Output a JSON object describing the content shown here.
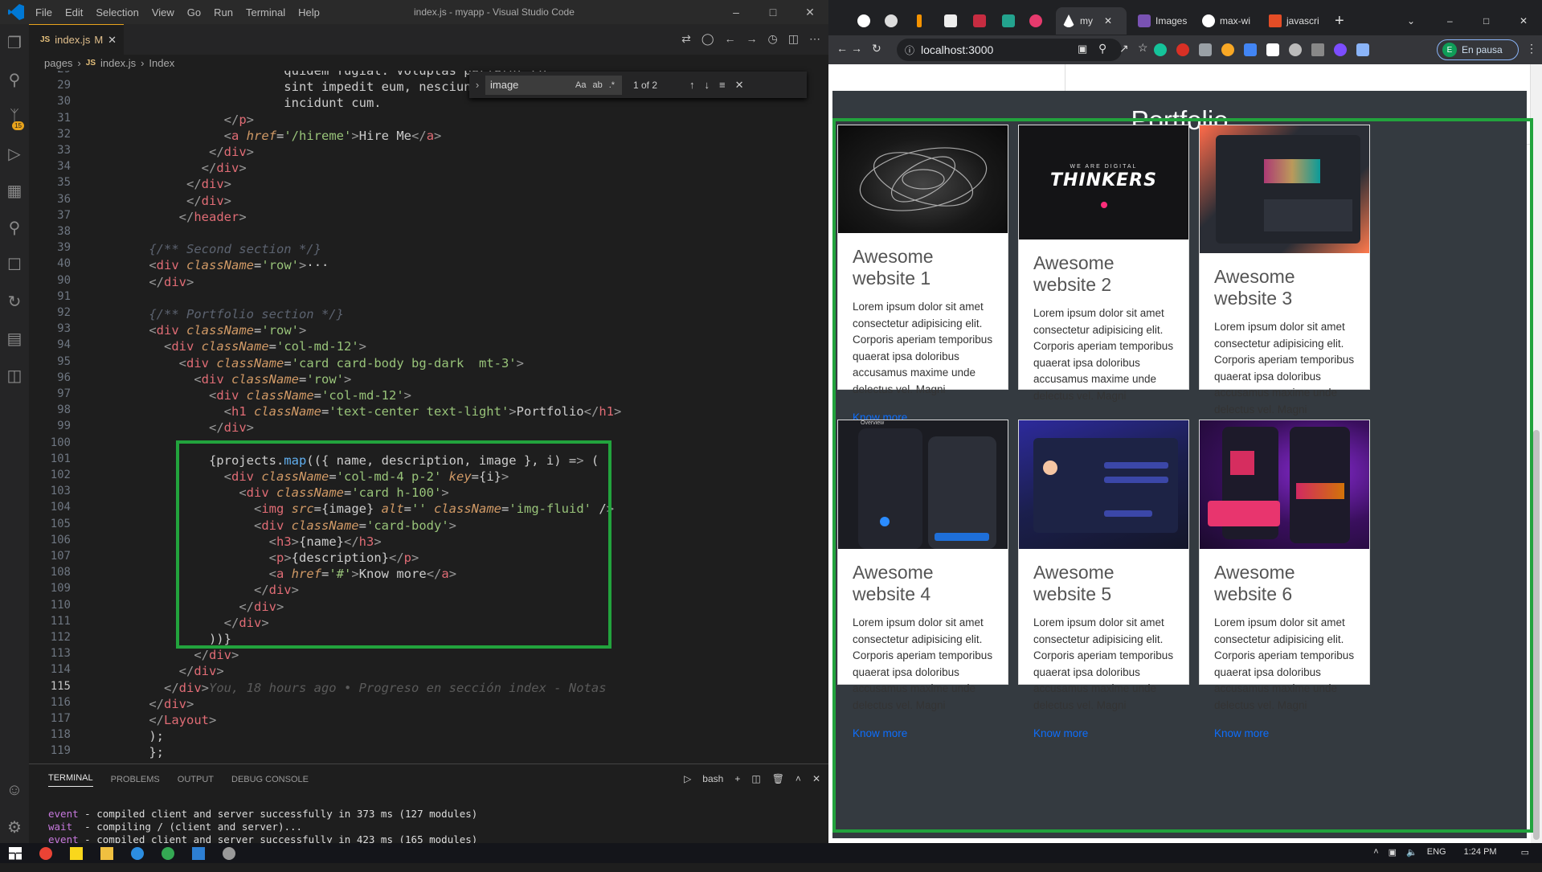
{
  "vscode": {
    "menu": [
      "File",
      "Edit",
      "Selection",
      "View",
      "Go",
      "Run",
      "Terminal",
      "Help"
    ],
    "window_title": "index.js - myapp - Visual Studio Code",
    "tab": {
      "label": "index.js",
      "status": "M"
    },
    "breadcrumb": [
      "pages",
      "index.js",
      "Index"
    ],
    "scm_badge": "15",
    "find": {
      "query": "image",
      "count": "1 of 2",
      "opt_case": "Aa",
      "opt_word": "ab",
      "opt_regex": ".*"
    },
    "lines": [
      {
        "n": "29",
        "code": "        quidem fugiat. Voluptas pariatur co"
      },
      {
        "n": "29",
        "code": "        sint impedit eum, nesciunt vero nih"
      },
      {
        "n": "30",
        "code": "        incidunt cum."
      },
      {
        "n": "31",
        "code": "      </p>"
      },
      {
        "n": "32",
        "code": "      <a href='/hireme'>Hire Me</a>"
      },
      {
        "n": "33",
        "code": "    </div>"
      },
      {
        "n": "34",
        "code": "   </div>"
      },
      {
        "n": "35",
        "code": " </div>"
      },
      {
        "n": "36",
        "code": " </div>"
      },
      {
        "n": "37",
        "code": "</header>"
      },
      {
        "n": "38",
        "code": ""
      },
      {
        "n": "39",
        "code": "{/** Second section */}"
      },
      {
        "n": "40",
        "code": "<div className='row'>···"
      },
      {
        "n": "90",
        "code": "</div>"
      },
      {
        "n": "91",
        "code": ""
      },
      {
        "n": "92",
        "code": "{/** Portfolio section */}"
      },
      {
        "n": "93",
        "code": "<div className='row'>"
      },
      {
        "n": "94",
        "code": "  <div className='col-md-12'>"
      },
      {
        "n": "95",
        "code": "    <div className='card card-body bg-dark  mt-3'>"
      },
      {
        "n": "96",
        "code": "      <div className='row'>"
      },
      {
        "n": "97",
        "code": "        <div className='col-md-12'>"
      },
      {
        "n": "98",
        "code": "          <h1 className='text-center text-light'>Portfolio</h1>"
      },
      {
        "n": "99",
        "code": "        </div>"
      },
      {
        "n": "100",
        "code": ""
      },
      {
        "n": "101",
        "code": "        {projects.map(({ name, description, image }, i) => ("
      },
      {
        "n": "102",
        "code": "          <div className='col-md-4 p-2' key={i}>"
      },
      {
        "n": "103",
        "code": "            <div className='card h-100'>"
      },
      {
        "n": "104",
        "code": "              <img src={image} alt='' className='img-fluid' />"
      },
      {
        "n": "105",
        "code": "              <div className='card-body'>"
      },
      {
        "n": "106",
        "code": "                <h3>{name}</h3>"
      },
      {
        "n": "107",
        "code": "                <p>{description}</p>"
      },
      {
        "n": "108",
        "code": "                <a href='#'>Know more</a>"
      },
      {
        "n": "109",
        "code": "              </div>"
      },
      {
        "n": "110",
        "code": "            </div>"
      },
      {
        "n": "111",
        "code": "          </div>"
      },
      {
        "n": "112",
        "code": "        ))}"
      },
      {
        "n": "113",
        "code": "      </div>"
      },
      {
        "n": "114",
        "code": "    </div>"
      },
      {
        "n": "115",
        "code": "  </div>"
      },
      {
        "n": "116",
        "code": "</div>"
      },
      {
        "n": "117",
        "code": "</Layout>"
      },
      {
        "n": "118",
        "code": ");"
      },
      {
        "n": "119",
        "code": "};"
      }
    ],
    "blame": "You, 18 hours ago • Progreso en sección index - Notas",
    "panel": {
      "tabs": [
        "TERMINAL",
        "PROBLEMS",
        "OUTPUT",
        "DEBUG CONSOLE"
      ],
      "shell": "bash",
      "lines": [
        {
          "tag": "event",
          "text": " - compiled client and server successfully in 373 ms (127 modules)"
        },
        {
          "tag": "wait",
          "text": "  - compiling / (client and server)..."
        },
        {
          "tag": "event",
          "text": " - compiled client and server successfully in 423 ms (165 modules)"
        }
      ]
    }
  },
  "chrome": {
    "tabs": [
      "my",
      "Images",
      "max-wi",
      "javascri"
    ],
    "url": "localhost:3000",
    "profile_initial": "E",
    "profile_label": "En pausa"
  },
  "portfolio": {
    "title": "Portfolio",
    "description": "Lorem ipsum dolor sit amet consectetur adipisicing elit. Corporis aperiam temporibus quaerat ipsa doloribus accusamus maxime unde delectus vel. Magni",
    "link": "Know more",
    "projects": [
      {
        "name": "Awesome website 1",
        "image": "abstract-rings"
      },
      {
        "name": "Awesome website 2",
        "image": "thinkers-dark",
        "img_text": "THINKERS",
        "img_top": "WE ARE DIGITAL"
      },
      {
        "name": "Awesome website 3",
        "image": "dashboard-dark"
      },
      {
        "name": "Awesome website 4",
        "image": "banking-mobile",
        "img_text": "Overview"
      },
      {
        "name": "Awesome website 5",
        "image": "community-app"
      },
      {
        "name": "Awesome website 6",
        "image": "music-app"
      }
    ]
  },
  "taskbar": {
    "lang": "ENG",
    "time": "1:24 PM"
  }
}
